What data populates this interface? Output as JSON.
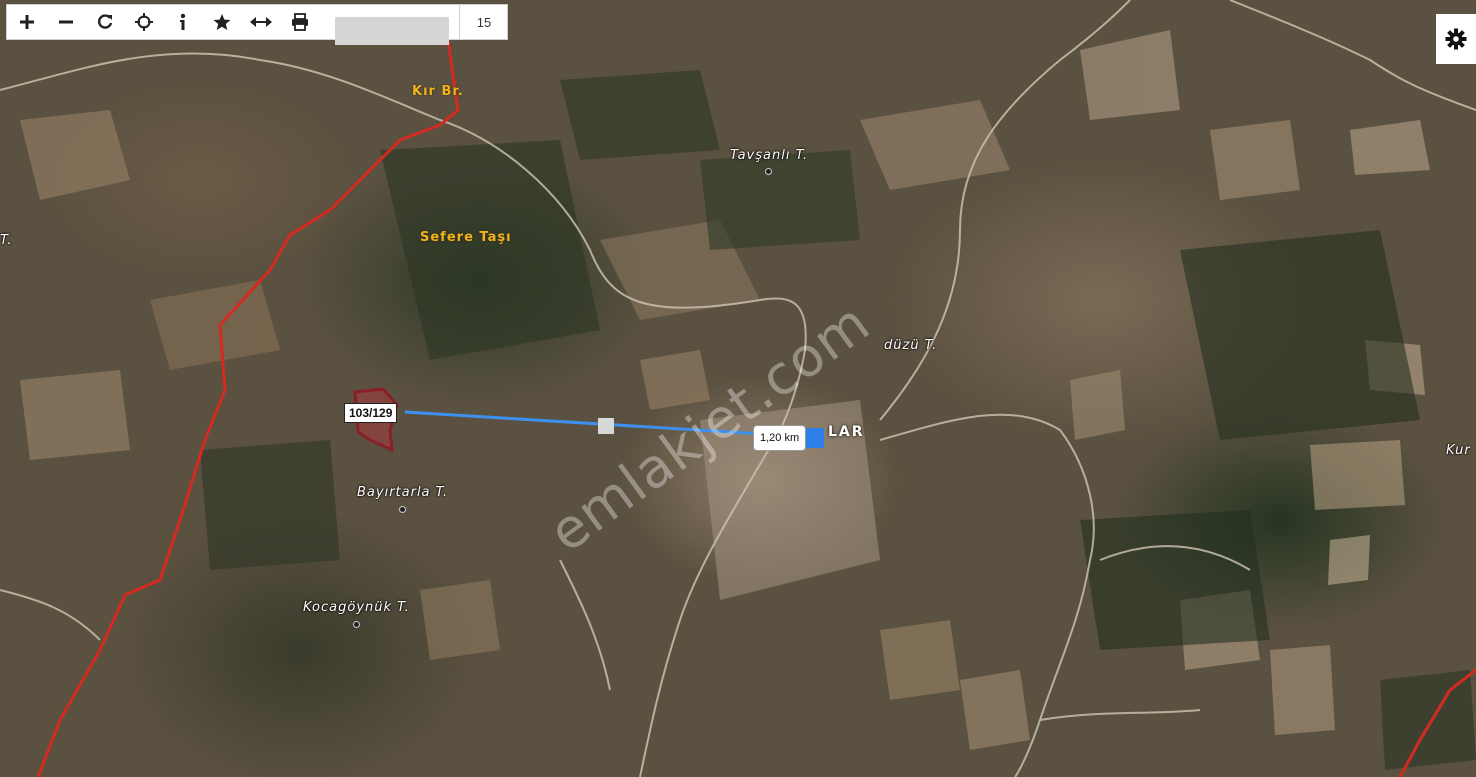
{
  "toolbar": {
    "zoom_in_label": "+",
    "zoom_out_label": "−",
    "zoom_level": "15"
  },
  "map": {
    "labels": {
      "kir_br": "Kır Br.",
      "tavsanli": "Tavşanlı T.",
      "sefere_tasi": "Sefere Taşı",
      "duzu": "düzü T.",
      "lar": "LAR",
      "bayirtarla": "Bayırtarla T.",
      "kocagoynuk": "Kocagöynük T.",
      "kur": "Kur",
      "left_t": "T."
    },
    "parcel_label": "103/129",
    "distance_label": "1,20 km",
    "watermark": "emlakjet.com"
  },
  "colors": {
    "boundary": "#d42a1f",
    "measure_line": "#3d8ff0",
    "parcel_fill": "#a43a3a"
  },
  "icons": [
    "plus-icon",
    "minus-icon",
    "refresh-icon",
    "locate-icon",
    "info-icon",
    "star-icon",
    "measure-icon",
    "print-icon",
    "gear-icon"
  ]
}
